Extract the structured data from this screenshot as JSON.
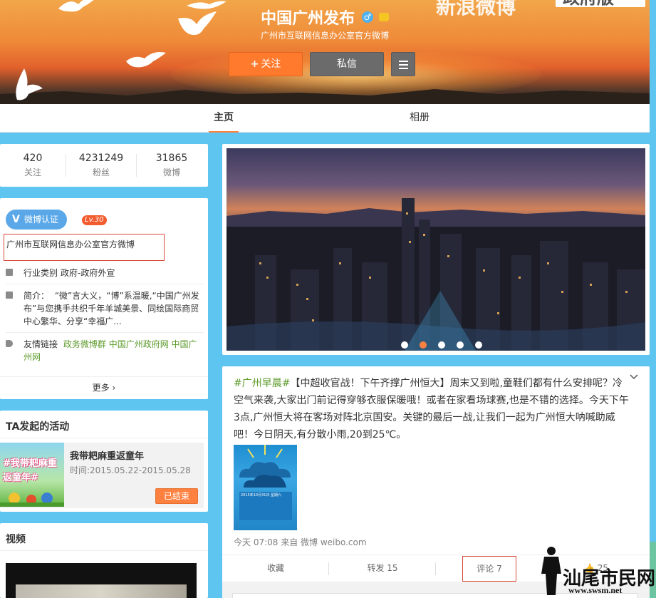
{
  "profile": {
    "name": "中国广州发布",
    "gender_icon": "male-icon",
    "gender_symbol": "♂",
    "vip_icon": "vip-icon",
    "description": "广州市互联网信息办公室官方微博",
    "follow_label": "关注",
    "message_label": "私信",
    "menu_icon": "menu-icon"
  },
  "cover": {
    "banner_text": "新浪微博",
    "banner_box_text": "政府版"
  },
  "tabs": [
    {
      "label": "主页",
      "active": true
    },
    {
      "label": "相册",
      "active": false
    }
  ],
  "stats": [
    {
      "value": "420",
      "label": "关注"
    },
    {
      "value": "4231249",
      "label": "粉丝"
    },
    {
      "value": "31865",
      "label": "微博"
    }
  ],
  "about": {
    "verify_badge": "微博认证",
    "level": "Lv.30",
    "verify_text": "广州市互联网信息办公室官方微博",
    "industry_key": "行业类别",
    "industry_value": "政府-政府外宣",
    "intro_key": "简介：",
    "intro_value": "“微”言大义，“博”系温暖,“中国广州发布”与您携手共织千年羊城美景、同绘国际商贸中心繁华、分享“幸福广...",
    "links_key": "友情链接",
    "links": [
      "政务微博群",
      "中国广州政府网",
      "中国广州网"
    ],
    "more_label": "更多",
    "icons": {
      "industry": "briefcase-icon",
      "intro": "edit-icon",
      "links": "tag-icon"
    }
  },
  "activity": {
    "title": "TA发起的活动",
    "item_title": "我带耙麻重返童年",
    "item_time": "时间:2015.05.22-2015.05.28",
    "item_status": "已结束",
    "image_text": "#我带耙麻重返童年#"
  },
  "video": {
    "title": "视频"
  },
  "carousel": {
    "dot_count": 6,
    "active_index": 1
  },
  "post": {
    "hashtag": "#广州早晨#",
    "text": "【中超收官战！下午齐撑广州恒大】周末又到啦,童鞋们都有什么安排呢？冷空气来袭,大家出门前记得穿够衣服保暖哦！或者在家看场球赛,也是不错的选择。今天下午3点,广州恒大将在客场对阵北京国安。关键的最后一战,让我们一起为广州恒大呐喊助威吧！今日阴天,有分散小雨,20到25℃。",
    "meta": "今天 07:08 来自 微博 weibo.com",
    "image_caption": "2015年10月31日 星期六",
    "actions": {
      "favorite": "收藏",
      "repost": "转发 15",
      "comment": "评论 7",
      "like": "25"
    }
  },
  "watermark": {
    "title": "汕尾市民网",
    "url": "www.swsm.net"
  },
  "colors": {
    "background": "#5ec4f0",
    "accent": "#ff8140",
    "link_green": "#5c9a2a",
    "verify_blue": "#5ba8e9"
  }
}
